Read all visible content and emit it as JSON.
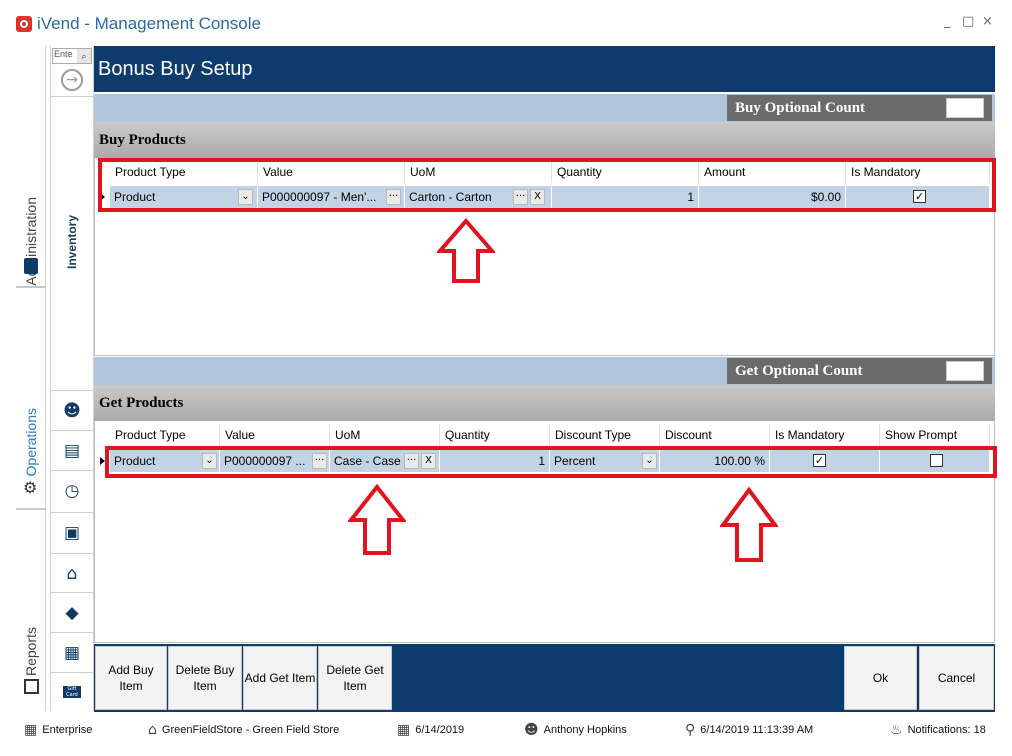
{
  "window": {
    "title": "iVend - Management Console",
    "minimize": "_",
    "maximize": "□",
    "close": "×"
  },
  "rail": {
    "administration": "Administration",
    "operations": "Operations",
    "reports": "Reports"
  },
  "nav": {
    "search_placeholder": "Ente",
    "search_icon": "⌕",
    "go_icon": "→",
    "inventory_label": "Inventory",
    "icons": [
      "person-dollar-icon",
      "register-icon",
      "clock-icon",
      "gift-icon",
      "store-icon",
      "tag-icon",
      "warehouse-icon",
      "gift-card-icon"
    ],
    "gift_card_label": "Gift Card"
  },
  "page": {
    "title": "Bonus Buy Setup"
  },
  "buy_optional": {
    "label": "Buy Optional Count",
    "value": ""
  },
  "get_optional": {
    "label": "Get Optional Count",
    "value": ""
  },
  "buy": {
    "title": "Buy Products",
    "columns": [
      "Product Type",
      "Value",
      "UoM",
      "Quantity",
      "Amount",
      "Is Mandatory"
    ],
    "row": {
      "product_type": "Product",
      "value": "P000000097 - Men'...",
      "uom": "Carton - Carton",
      "quantity": "1",
      "amount": "$0.00",
      "is_mandatory": true
    }
  },
  "get": {
    "title": "Get Products",
    "columns": [
      "Product Type",
      "Value",
      "UoM",
      "Quantity",
      "Discount Type",
      "Discount",
      "Is Mandatory",
      "Show Prompt"
    ],
    "row": {
      "product_type": "Product",
      "value": "P000000097 ...",
      "uom": "Case - Case",
      "quantity": "1",
      "discount_type": "Percent",
      "discount": "100.00 %",
      "is_mandatory": true,
      "show_prompt": false
    }
  },
  "glyphs": {
    "dropdown": "⌄",
    "ellipsis": "···",
    "clear": "X",
    "check": "✓"
  },
  "buttons": {
    "add_buy": "Add Buy Item",
    "delete_buy": "Delete Buy Item",
    "add_get": "Add Get Item",
    "delete_get": "Delete Get Item",
    "ok": "Ok",
    "cancel": "Cancel"
  },
  "status": {
    "enterprise": "Enterprise",
    "store": "GreenFieldStore - Green Field Store",
    "date": "6/14/2019",
    "user": "Anthony Hopkins",
    "login_time": "6/14/2019 11:13:39 AM",
    "notifications": "Notifications: 18"
  },
  "colors": {
    "accent": "#0d3b6e",
    "highlight": "#e0141e",
    "row": "#c3d3e6"
  }
}
